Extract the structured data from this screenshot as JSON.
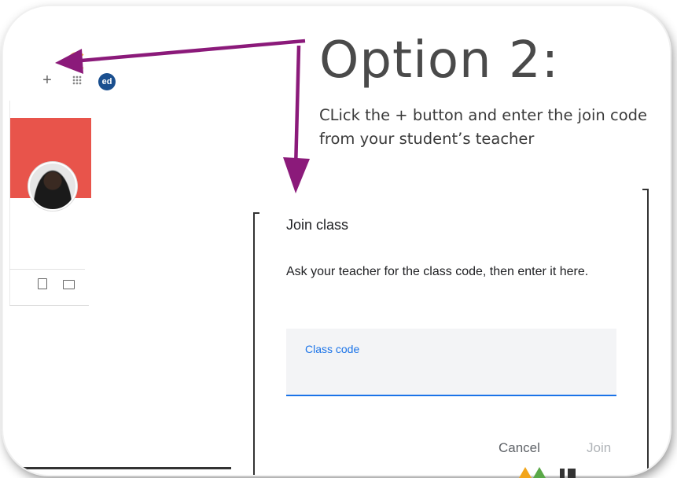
{
  "slide": {
    "heading": "Option 2:",
    "instruction": "CLick the + button and enter the join code from your student’s teacher"
  },
  "toolbar": {
    "avatar_initials": "ed",
    "icons": [
      "plus-icon",
      "apps-grid-icon"
    ]
  },
  "class_card": {
    "header_color": "#e8544b",
    "icons": [
      "assignment-icon",
      "folder-icon"
    ]
  },
  "dialog": {
    "title": "Join class",
    "body": "Ask your teacher for the class code, then enter it here.",
    "code_field": {
      "label": "Class code",
      "value": ""
    },
    "cancel_label": "Cancel",
    "join_label": "Join"
  },
  "colors": {
    "arrow": "#8b1a7a",
    "accent_blue": "#1a73e8",
    "avatar_bg": "#1a4f8f"
  }
}
